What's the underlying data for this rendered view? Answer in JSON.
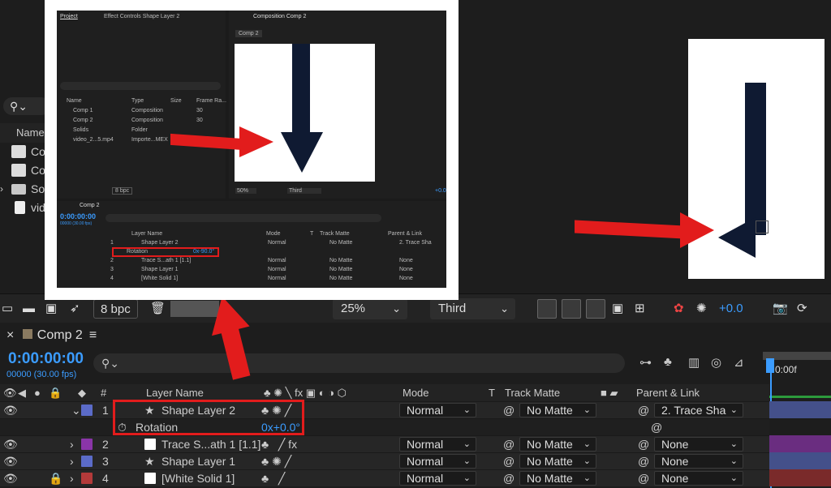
{
  "project_panel": {
    "name_header": "Name",
    "items": [
      {
        "label": "Co",
        "icon": "composition-icon"
      },
      {
        "label": "Co",
        "icon": "composition-icon"
      },
      {
        "label": "So",
        "icon": "folder-icon"
      },
      {
        "label": "vid",
        "icon": "video-file-icon"
      }
    ]
  },
  "toolbar": {
    "bpc": "8 bpc",
    "zoom": "25%",
    "view": "Third",
    "exposure": "+0.0"
  },
  "timeline": {
    "tab_title": "Comp 2",
    "timecode": "0:00:00:00",
    "frames": "00000 (30.00 fps)",
    "columns": {
      "num": "#",
      "layer_name": "Layer Name",
      "mode": "Mode",
      "t": "T",
      "track_matte": "Track Matte",
      "parent": "Parent & Link"
    },
    "ruler_label": "0:00f",
    "layers": [
      {
        "num": "1",
        "name": "Shape Layer 2",
        "color": "#5b6bc8",
        "mode": "Normal",
        "matte": "No Matte",
        "parent": "2. Trace Sha",
        "star": true
      },
      {
        "num": "",
        "name": "Rotation",
        "value": "0x+0.0°"
      },
      {
        "num": "2",
        "name": "Trace S...ath 1 [1.1]",
        "color": "#8a35a8",
        "mode": "Normal",
        "matte": "No Matte",
        "parent": "None",
        "star": false
      },
      {
        "num": "3",
        "name": "Shape Layer 1",
        "color": "#5b6bc8",
        "mode": "Normal",
        "matte": "No Matte",
        "parent": "None",
        "star": true
      },
      {
        "num": "4",
        "name": "[White Solid 1]",
        "color": "#b33a3a",
        "mode": "Normal",
        "matte": "No Matte",
        "parent": "None",
        "star": false
      }
    ]
  },
  "inset": {
    "project_tab": "Project",
    "effect_tab": "Effect Controls Shape Layer 2",
    "comp_tab": "Composition Comp 2",
    "comp_chip": "Comp 2",
    "proj_headers": [
      "Name",
      "Type",
      "Size",
      "Frame Ra..."
    ],
    "proj_items": [
      {
        "name": "Comp 1",
        "type": "Composition",
        "fr": "30"
      },
      {
        "name": "Comp 2",
        "type": "Composition",
        "fr": "30"
      },
      {
        "name": "Solids",
        "type": "Folder",
        "fr": ""
      },
      {
        "name": "video_2...5.mp4",
        "type": "Importe...MEX",
        "fr": ""
      }
    ],
    "bpc": "8 bpc",
    "zoom": "50%",
    "view": "Third",
    "exposure": "+0.0",
    "tl_tab": "Comp 2",
    "timecode": "0:00:00:00",
    "frames": "00000 (30.00 fps)",
    "tl_headers": {
      "layer_name": "Layer Name",
      "mode": "Mode",
      "t": "T",
      "track_matte": "Track Matte",
      "parent": "Parent & Link"
    },
    "layers": [
      {
        "num": "1",
        "name": "Shape Layer 2",
        "mode": "Normal",
        "matte": "No Matte",
        "parent": "2. Trace Sha"
      },
      {
        "num": "",
        "name": "Rotation",
        "value": "0x-90.0°"
      },
      {
        "num": "2",
        "name": "Trace S...ath 1 [1.1]",
        "mode": "Normal",
        "matte": "No Matte",
        "parent": "None"
      },
      {
        "num": "3",
        "name": "Shape Layer 1",
        "mode": "Normal",
        "matte": "No Matte",
        "parent": "None"
      },
      {
        "num": "4",
        "name": "[White Solid 1]",
        "mode": "Normal",
        "matte": "No Matte",
        "parent": "None"
      }
    ]
  },
  "colors": {
    "accent_blue": "#3b9cff",
    "annotation_red": "#e21c1c",
    "shape_navy": "#0f1a32"
  }
}
